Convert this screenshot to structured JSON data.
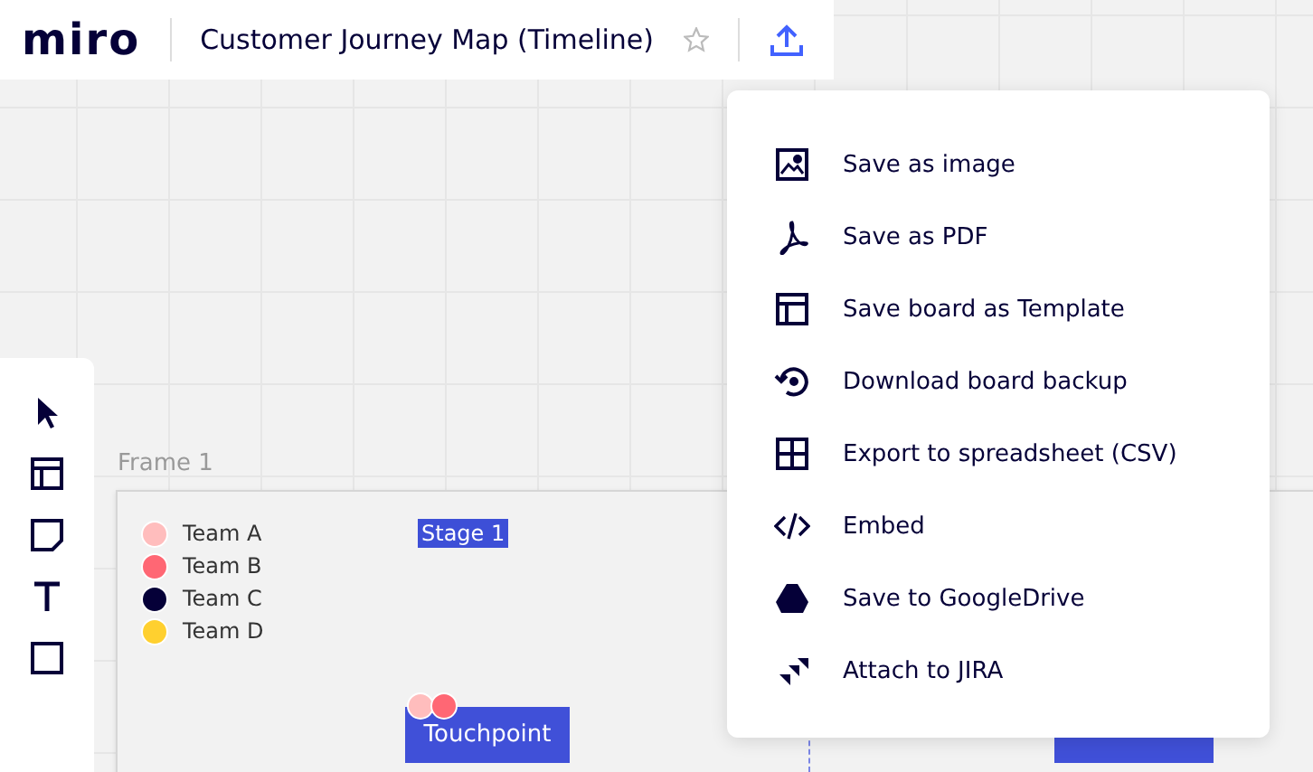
{
  "header": {
    "logo": "miro",
    "board_title": "Customer Journey Map (Timeline)",
    "starred": false
  },
  "frame": {
    "title": "Frame 1",
    "legend": [
      {
        "label": "Team A",
        "color": "#ffbdbd"
      },
      {
        "label": "Team B",
        "color": "#ff6774"
      },
      {
        "label": "Team C",
        "color": "#050038"
      },
      {
        "label": "Team D",
        "color": "#ffd02f"
      }
    ],
    "stage": "Stage 1",
    "touchpoint": {
      "label": "Touchpoint",
      "dots": [
        {
          "color": "#ffbdbd"
        },
        {
          "color": "#ff6774"
        }
      ]
    }
  },
  "export_menu": [
    "Save as image",
    "Save as PDF",
    "Save board as Template",
    "Download board backup",
    "Export to spreadsheet (CSV)",
    "Embed",
    "Save to GoogleDrive",
    "Attach to JIRA"
  ]
}
